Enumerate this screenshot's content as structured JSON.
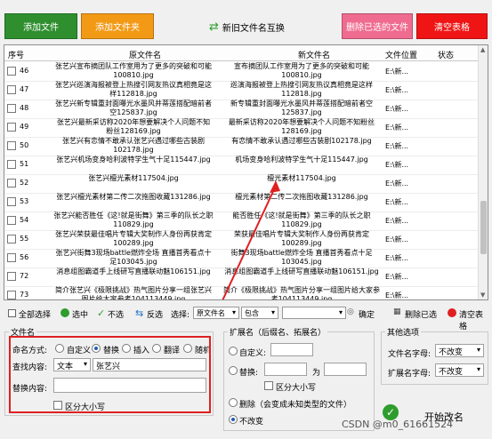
{
  "top_buttons": {
    "add_file": "添加文件",
    "add_folder": "添加文件夹",
    "swap": "新旧文件名互换",
    "delete_selected": "删除已选的文件",
    "clear": "清空表格"
  },
  "grid": {
    "columns": {
      "no": "序号",
      "orig": "原文件名",
      "new": "新文件名",
      "loc": "文件位置",
      "status": "状态"
    },
    "rows": [
      {
        "no": "46",
        "orig": "张艺兴宣布摘团队工作室用为了更多的突破和可能100810.jpg",
        "new": "宣布摘团队工作室用为了更多的突破和可能100810.jpg",
        "loc": "E:\\新..."
      },
      {
        "no": "47",
        "orig": "张艺兴巡演海报被登上热搜引网友热议真相竟是这样112818.jpg",
        "new": "巡演海报被登上热搜引网友热议真相竟是这样112818.jpg",
        "loc": "E:\\新..."
      },
      {
        "no": "48",
        "orig": "张艺兴新专辑重封面曝光水墨风井蒂莲搭配暗前者空125837.jpg",
        "new": "新专辑重封面曝光水墨风井蒂莲搭配暗前者空125837.jpg",
        "loc": "E:\\新..."
      },
      {
        "no": "49",
        "orig": "张艺兴最新采访称2020年想要解决个人问题不知粉丝128169.jpg",
        "new": "最新采访称2020年想要解决个人问题不知粉丝128169.jpg",
        "loc": "E:\\新..."
      },
      {
        "no": "50",
        "orig": "张艺兴有恋情不敢承认张艺兴遇过哪些古装剧102178.jpg",
        "new": "有恋情不敢承认遇过哪些古装剧102178.jpg",
        "loc": "E:\\新..."
      },
      {
        "no": "51",
        "orig": "张艺兴机场变身哈利波特学生气十足115447.jpg",
        "new": "机场变身哈利波特学生气十足115447.jpg",
        "loc": "E:\\新..."
      },
      {
        "no": "52",
        "orig": "张艺兴檀光素材117504.jpg",
        "new": "檀光素材117504.jpg",
        "loc": "E:\\新..."
      },
      {
        "no": "53",
        "orig": "张艺兴檀光素材第二传二次拖图收藏131286.jpg",
        "new": "檀光素材第二传二次拖图收藏131286.jpg",
        "loc": "E:\\新..."
      },
      {
        "no": "54",
        "orig": "张艺兴能否胜任《这!就是街舞》第三季的队长之职110829.jpg",
        "new": "能否胜任《这!就是街舞》第三季的队长之职110829.jpg",
        "loc": "E:\\新..."
      },
      {
        "no": "55",
        "orig": "张艺兴荣获最佳唱片专辑大奖制作人身份再获肯定100289.jpg",
        "new": "荣获最佳唱片专辑大奖制作人身份再获肯定100289.jpg",
        "loc": "E:\\新..."
      },
      {
        "no": "56",
        "orig": "张艺兴街舞3现场battle燃炸全场 直播首秀看点十足103045.jpg",
        "new": "街舞3现场battle燃炸全场 直播首秀看点十足103045.jpg",
        "loc": "E:\\新..."
      },
      {
        "no": "72",
        "orig": "消息组图霸道手上线研写直播联动魅106151.jpg",
        "new": "消息组图霸道手上线研写直播联动魅106151.jpg",
        "loc": "E:\\新..."
      },
      {
        "no": "73",
        "orig": "简介张艺兴《极限挑战》热气图片分享一组张艺兴图片给大家参考104113449.jpg",
        "new": "简介《极限挑战》热气图片分享一组图片给大家参考104113449.jpg",
        "loc": "E:\\新..."
      }
    ]
  },
  "toolbar": {
    "select_all": "全部选择",
    "select": "选中",
    "unselect": "不选",
    "invert": "反选",
    "choose": "选择:",
    "opt1": "原文件名",
    "opt2": "包含",
    "confirm": "确定",
    "delete_sel": "删除已选",
    "clear": "清空表格"
  },
  "filename": {
    "title": "文件名",
    "mode_label": "命名方式:",
    "modes": [
      "自定义",
      "替换",
      "插入",
      "翻译",
      "随机"
    ],
    "find_label": "查找内容:",
    "find_type": "文本",
    "find_value": "张艺兴",
    "replace_label": "替换内容:",
    "replace_value": "",
    "case_label": "区分大小写"
  },
  "ext": {
    "title": "扩展名（后缀名、拓展名）",
    "custom": "自定义:",
    "replace": "替换:",
    "as": "为",
    "case": "区分大小写",
    "delete": "删除（会变成未知类型的文件）",
    "nochange": "不改变"
  },
  "other": {
    "title": "其他选项",
    "fname_case_label": "文件名字母:",
    "fname_case": "不改变",
    "ext_case_label": "扩展名字母:",
    "ext_case": "不改变"
  },
  "start_label": "开始改名",
  "watermark": "CSDN @m0_61661524"
}
